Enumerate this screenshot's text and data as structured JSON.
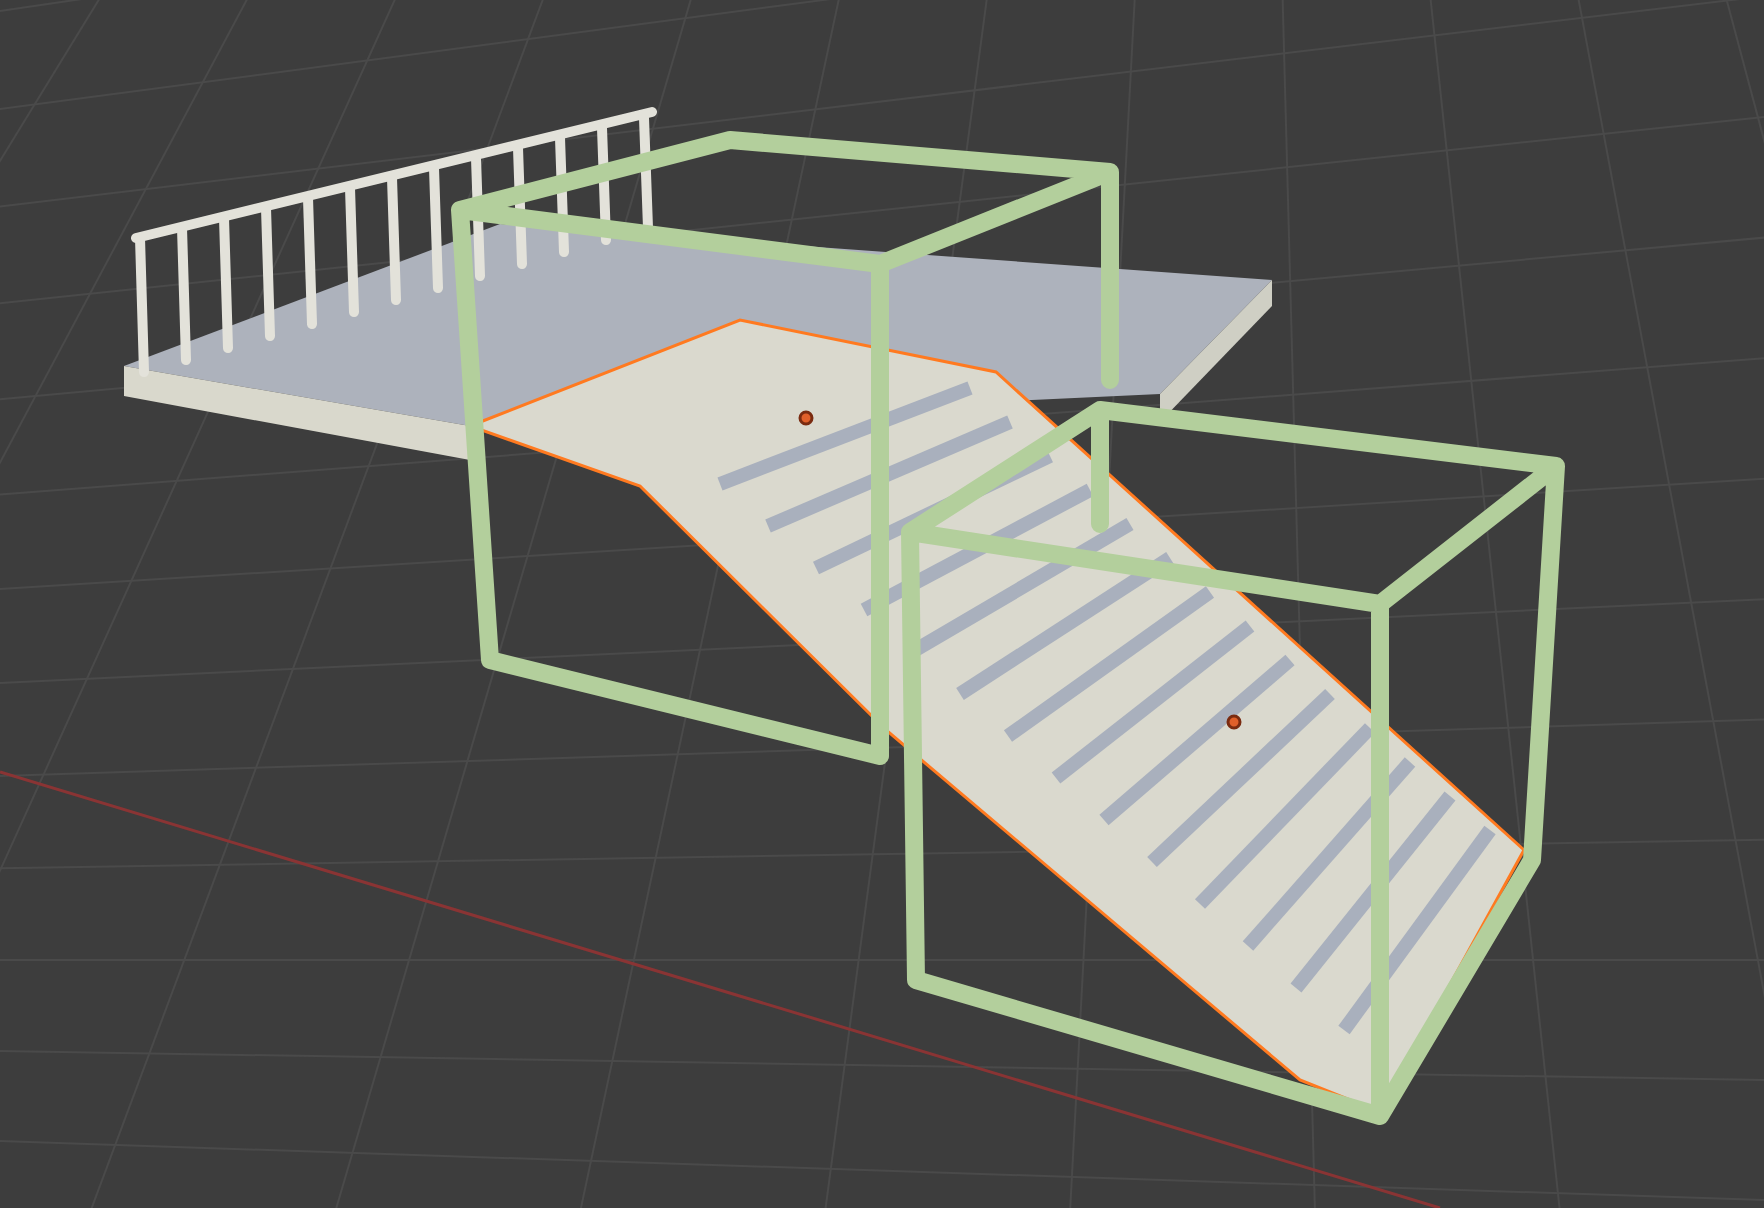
{
  "objects": [
    {
      "kind": "landing",
      "selected": false
    },
    {
      "kind": "railing",
      "selected": false
    },
    {
      "kind": "stairs",
      "selected": true
    },
    {
      "kind": "frame",
      "selected": false
    },
    {
      "kind": "frame",
      "selected": false
    }
  ]
}
